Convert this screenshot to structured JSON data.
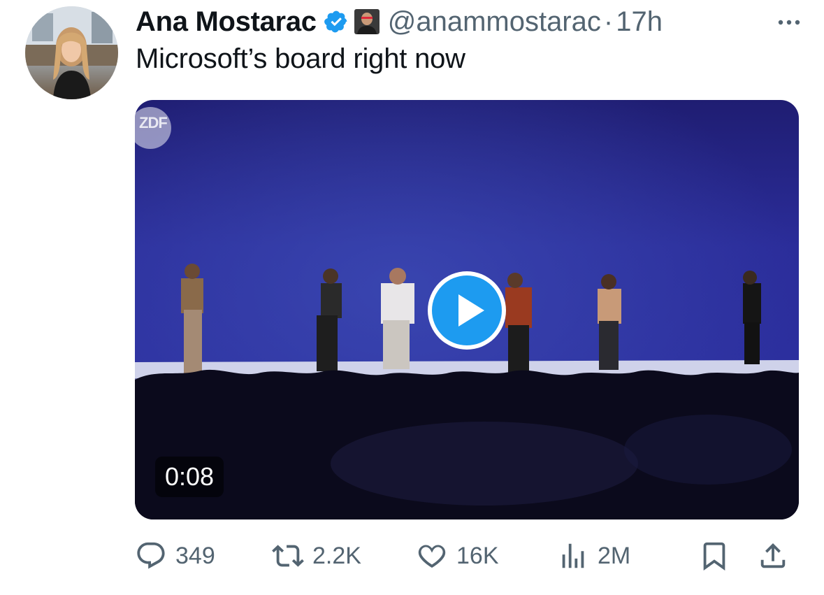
{
  "tweet": {
    "display_name": "Ana Mostarac",
    "handle": "@anammostarac",
    "separator": "·",
    "time": "17h",
    "text": "Microsoft’s board right now"
  },
  "media": {
    "watermark": "ZDF",
    "duration": "0:08"
  },
  "actions": {
    "replies": "349",
    "reposts": "2.2K",
    "likes": "16K",
    "views": "2M"
  },
  "icons": {
    "avatar": "profile-photo",
    "verified": "verified-badge-icon",
    "affiliate": "affiliate-badge-icon",
    "more": "more-icon",
    "play": "play-icon",
    "reply": "reply-icon",
    "repost": "repost-icon",
    "like": "heart-icon",
    "views": "views-icon",
    "bookmark": "bookmark-icon",
    "share": "share-icon"
  },
  "colors": {
    "text": "#0f1419",
    "secondary": "#536471",
    "accent": "#1d9bf0"
  }
}
